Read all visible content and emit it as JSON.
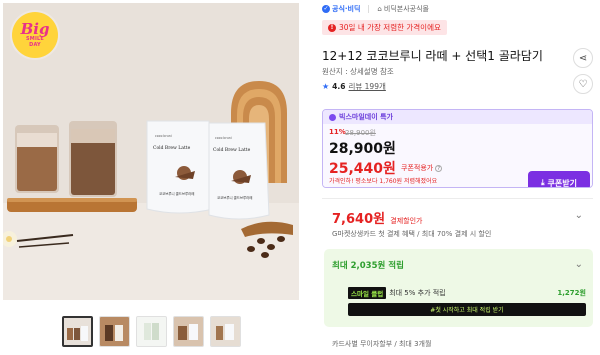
{
  "badge": {
    "line1": "Big",
    "line2": "SMILE",
    "line3": "DAY"
  },
  "product_pack": {
    "brand": "Cold Brew Latte",
    "title_kr": "코코브루니 콜드브루라떼"
  },
  "store": {
    "badge": "공식·비딕",
    "name": "비딕본사공식몰"
  },
  "lowest_price_banner": "30일 내 가장 저렴한 가격이에요",
  "title": "12+12 코코브루니 라떼 + 선택1 골라담기",
  "origin": "원산지 : 상세설명 참조",
  "rating": {
    "score": "4.6",
    "reviews": "리뷰 199개"
  },
  "price_card": {
    "header": "빅스마일데이 특가",
    "discount_pct": "11%",
    "original_price": "28,900원",
    "price": "28,900원",
    "coupon_price": "25,440원",
    "coupon_label": "쿠폰적용가",
    "note": "가격인하! 평소보다 1,760원 저렴해졌어요",
    "coupon_button": "쿠폰받기"
  },
  "card_discount": {
    "amount": "7,640원",
    "label": "결제할인가",
    "desc": "G마켓상생카드 첫 결제 혜택 / 최대 70% 결제 시 할인"
  },
  "points": {
    "title": "최대 2,035원 적립",
    "member_tag": "스마일",
    "member_tag2": "클럽",
    "member_text": "최대 5% 추가 적립",
    "member_value": "1,272원",
    "member_button": "#첫 시작하고 최대 적립 받기"
  },
  "bottom_note": "카드사별 무이자할부 / 최대 3개월",
  "icons": {
    "share": "share-icon",
    "wish": "heart-icon",
    "chevron": "chevron-down-icon",
    "download": "download-icon"
  },
  "colors": {
    "accent_red": "#e52222",
    "accent_purple": "#7b2fe2",
    "accent_green": "#2e9e2e",
    "badge_yellow": "#ffd43b"
  }
}
